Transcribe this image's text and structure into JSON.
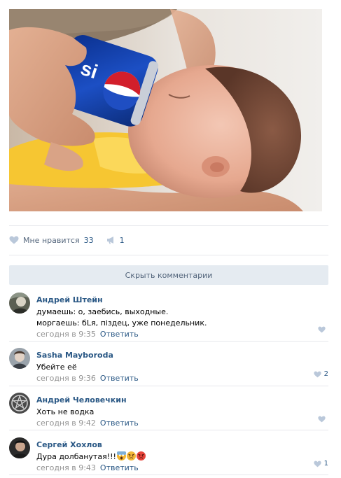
{
  "post": {
    "actions": {
      "like_label": "Мне нравится",
      "like_count": "33",
      "share_count": "1"
    }
  },
  "comments_toggle": {
    "label": "Скрыть комментарии"
  },
  "comments": [
    {
      "author": "Андрей Штейн",
      "lines": [
        "думаешь: о, заебись, выходные.",
        "моргаешь: бLя, пiздец, уже понедельник."
      ],
      "time": "сегодня в 9:35",
      "reply_label": "Ответить",
      "likes": ""
    },
    {
      "author": "Sasha Mayboroda",
      "lines": [
        "Убейте её"
      ],
      "time": "сегодня в 9:36",
      "reply_label": "Ответить",
      "likes": "2"
    },
    {
      "author": "Андрей Человечкин",
      "lines": [
        "Хоть не водка"
      ],
      "time": "сегодня в 9:42",
      "reply_label": "Ответить",
      "likes": ""
    },
    {
      "author": "Сергей Хохлов",
      "lines": [
        "Дура долбанутая!!!"
      ],
      "time": "сегодня в 9:43",
      "reply_label": "Ответить",
      "likes": "1"
    }
  ],
  "colors": {
    "link": "#2a5885",
    "muted": "#939393",
    "separator": "#e7e8ec",
    "toggle_bg": "#e5ebf1"
  },
  "icons": [
    "heart-icon",
    "megaphone-icon",
    "screaming-face-emoji",
    "angry-face-emoji",
    "pouting-face-emoji"
  ]
}
